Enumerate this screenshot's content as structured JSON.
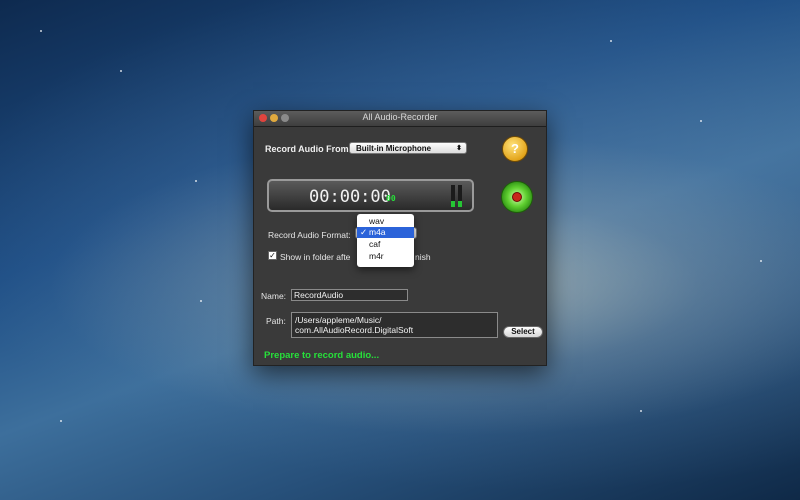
{
  "window": {
    "title": "All Audio-Recorder"
  },
  "source": {
    "label": "Record Audio From:",
    "selected": "Built-in Microphone"
  },
  "help": {
    "glyph": "?"
  },
  "timer": {
    "time": "00:00:00",
    "ms": "00",
    "level_left": 0.2,
    "level_right": 0.2
  },
  "format": {
    "label": "Record Audio Format:",
    "options": [
      {
        "label": "wav",
        "selected": false
      },
      {
        "label": "m4a",
        "selected": true
      },
      {
        "label": "caf",
        "selected": false
      },
      {
        "label": "m4r",
        "selected": false
      }
    ],
    "check_glyph": "✓"
  },
  "show_in_folder": {
    "label_part1": "Show in folder afte",
    "label_part2": "nish",
    "checked": true,
    "check_glyph": "✓"
  },
  "name": {
    "label": "Name:",
    "value": "RecordAudio"
  },
  "path": {
    "label": "Path:",
    "line1": "/Users/appleme/Music/",
    "line2": "com.AllAudioRecord.DigitalSoft",
    "select_label": "Select"
  },
  "status": {
    "text": "Prepare to record audio..."
  },
  "colors": {
    "accent_green": "#27e03a",
    "selection_blue": "#2b63d9"
  }
}
